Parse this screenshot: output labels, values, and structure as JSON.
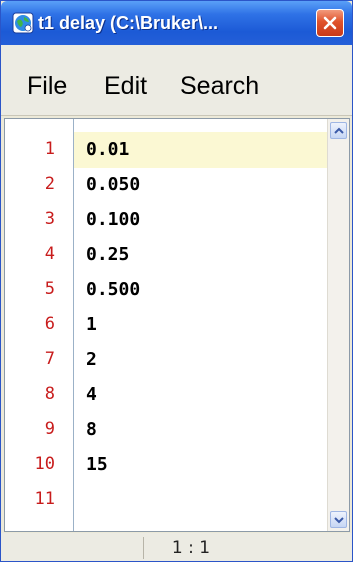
{
  "window": {
    "title": "t1 delay (C:\\Bruker\\...",
    "icon": "app-globe-icon",
    "close_icon": "close-icon"
  },
  "menu": {
    "items": [
      {
        "label": "File"
      },
      {
        "label": "Edit"
      },
      {
        "label": "Search"
      }
    ]
  },
  "editor": {
    "line_numbers": [
      "1",
      "2",
      "3",
      "4",
      "5",
      "6",
      "7",
      "8",
      "9",
      "10",
      "11"
    ],
    "lines": [
      "0.01",
      "0.050",
      "0.100",
      "0.25",
      "0.500",
      "1",
      "2",
      "4",
      "8",
      "15",
      ""
    ],
    "current_line": 1,
    "colors": {
      "line_number": "#c81c1c",
      "current_line_bg": "#fbf8d3",
      "text": "#000000"
    }
  },
  "status": {
    "cursor_position": "1 : 1"
  }
}
